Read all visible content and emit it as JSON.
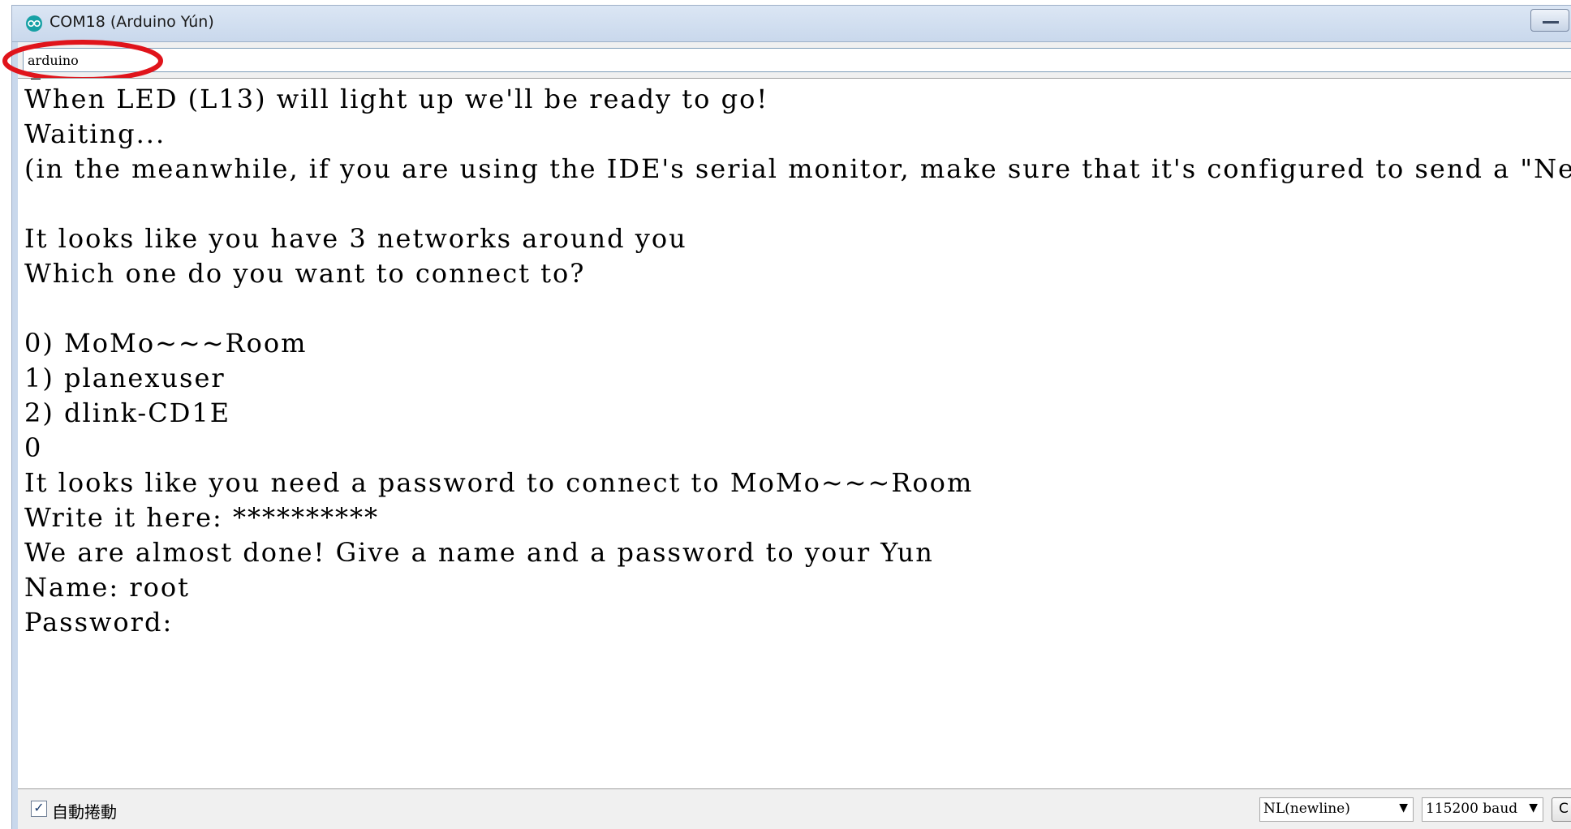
{
  "window": {
    "title": "COM18 (Arduino Yún)"
  },
  "send_input": {
    "value": "arduino"
  },
  "console": {
    "lines": [
      "When LED (L13) will light up we'll be ready to go!",
      "Waiting...",
      "(in the meanwhile, if you are using the IDE's serial monitor, make sure that it's configured to send a \"Newli",
      "",
      "It looks like you have 3 networks around you",
      "Which one do you want to connect to?",
      "",
      "0) MoMo~~~Room",
      "1) planexuser",
      "2) dlink-CD1E",
      "0",
      "It looks like you need a password to connect to MoMo~~~Room",
      "Write it here: **********",
      "We are almost done! Give a name and a password to your Yun",
      "Name: root",
      "Password:"
    ]
  },
  "footer": {
    "autoscroll_checked": true,
    "autoscroll_label": "自動捲動",
    "line_ending": "NL(newline)",
    "baud_rate": "115200 baud",
    "clear_button_label": "C"
  },
  "colors": {
    "annotation": "#e0141b",
    "titlebar": "#c9d8ec"
  },
  "icons": {
    "app": "arduino-logo-icon",
    "minimize": "minimize-icon",
    "dropdown": "chevron-down-icon",
    "check": "checkmark-icon"
  }
}
